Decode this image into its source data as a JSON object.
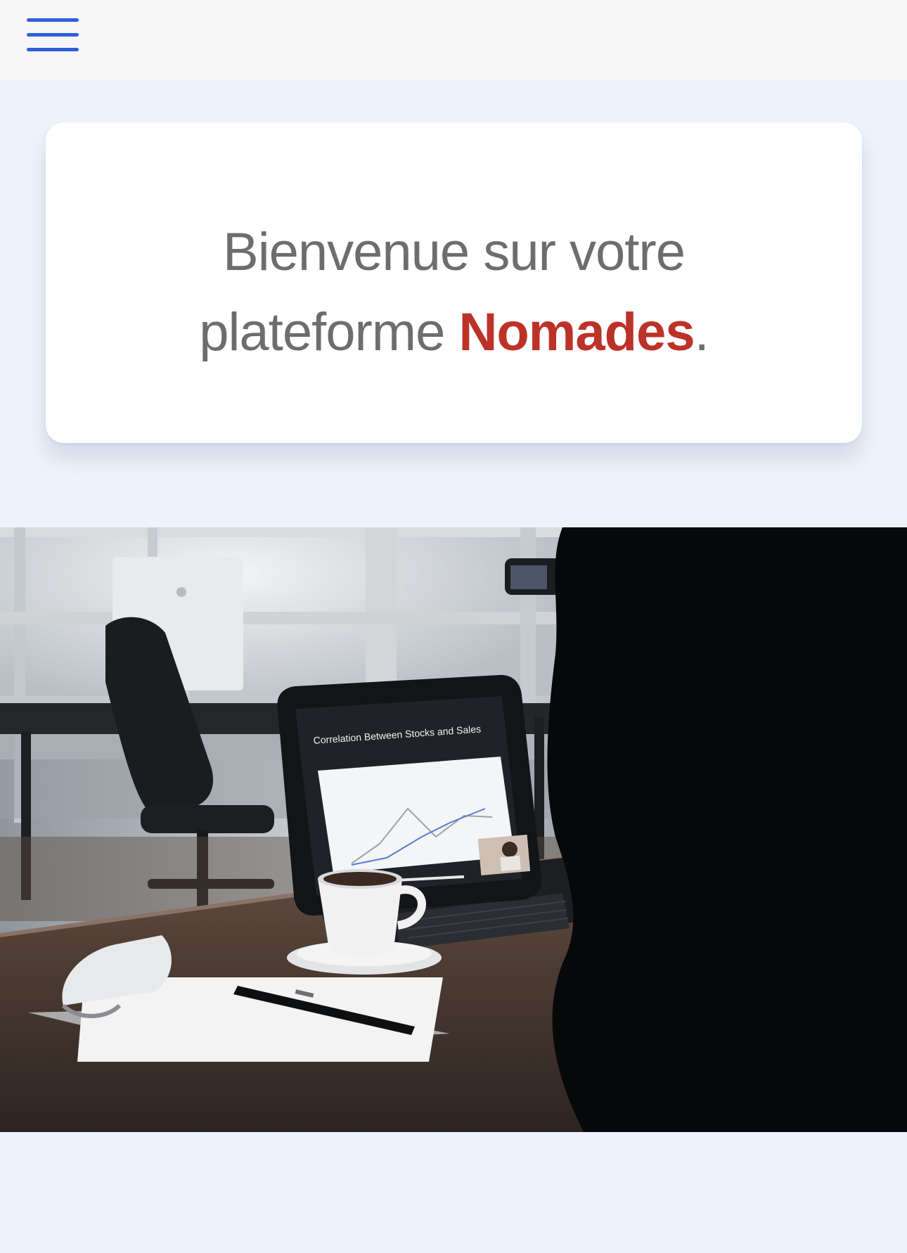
{
  "header": {
    "menu_icon": "hamburger-menu-icon",
    "menu_color": "#2f5fd6"
  },
  "welcome": {
    "line1": "Bienvenue sur votre",
    "line2_prefix": "plateforme ",
    "brand": "Nomades",
    "line2_suffix": ".",
    "brand_color": "#bd3228"
  },
  "hero": {
    "tablet_chart_title": "Correlation Between Stocks and Sales"
  }
}
